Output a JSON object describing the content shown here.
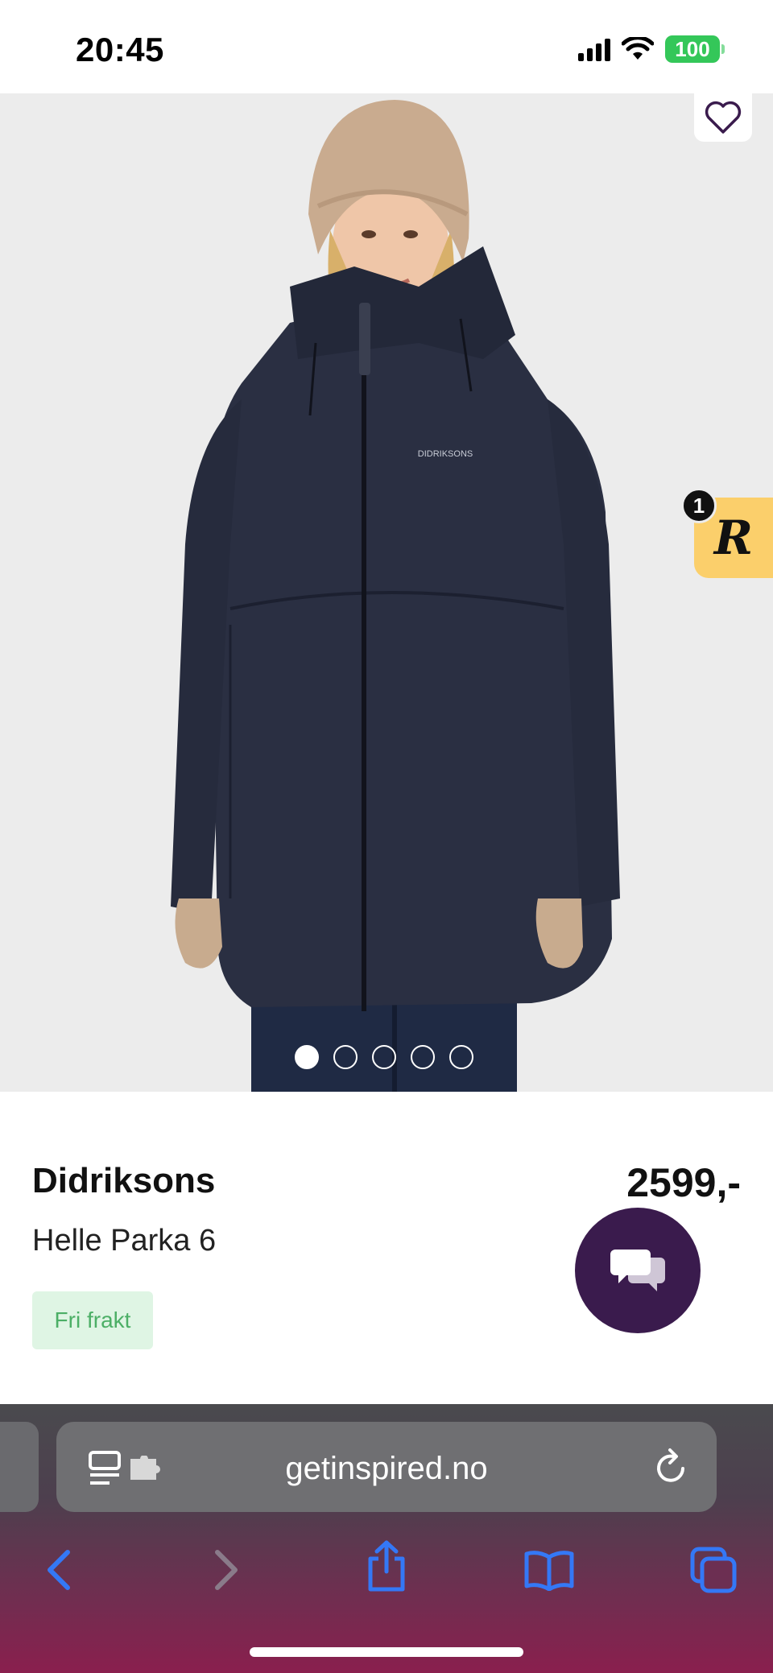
{
  "status_bar": {
    "time": "20:45",
    "battery": "100"
  },
  "product": {
    "brand": "Didriksons",
    "name": "Helle Parka 6",
    "price": "2599,-",
    "shipping_tag": "Fri frakt",
    "jacket_print": "DIDRIKSONS"
  },
  "gallery": {
    "image_count": 5,
    "active_index": 0
  },
  "reward_badge": {
    "count": "1",
    "letter": "R"
  },
  "browser": {
    "url": "getinspired.no"
  },
  "colors": {
    "chat_button": "#3a1b4d",
    "reward_badge": "#fbcf6b",
    "shipping_tag_bg": "#dff5e4",
    "shipping_tag_text": "#4caf66",
    "browser_accent": "#3478f6"
  },
  "icons": {
    "favorite": "heart-icon",
    "chat": "chat-bubbles-icon",
    "reader": "reader-mode-icon",
    "extensions": "puzzle-icon",
    "reload": "reload-icon",
    "back": "chevron-left-icon",
    "forward": "chevron-right-icon",
    "share": "share-icon",
    "bookmarks": "book-icon",
    "tabs": "tabs-icon"
  }
}
